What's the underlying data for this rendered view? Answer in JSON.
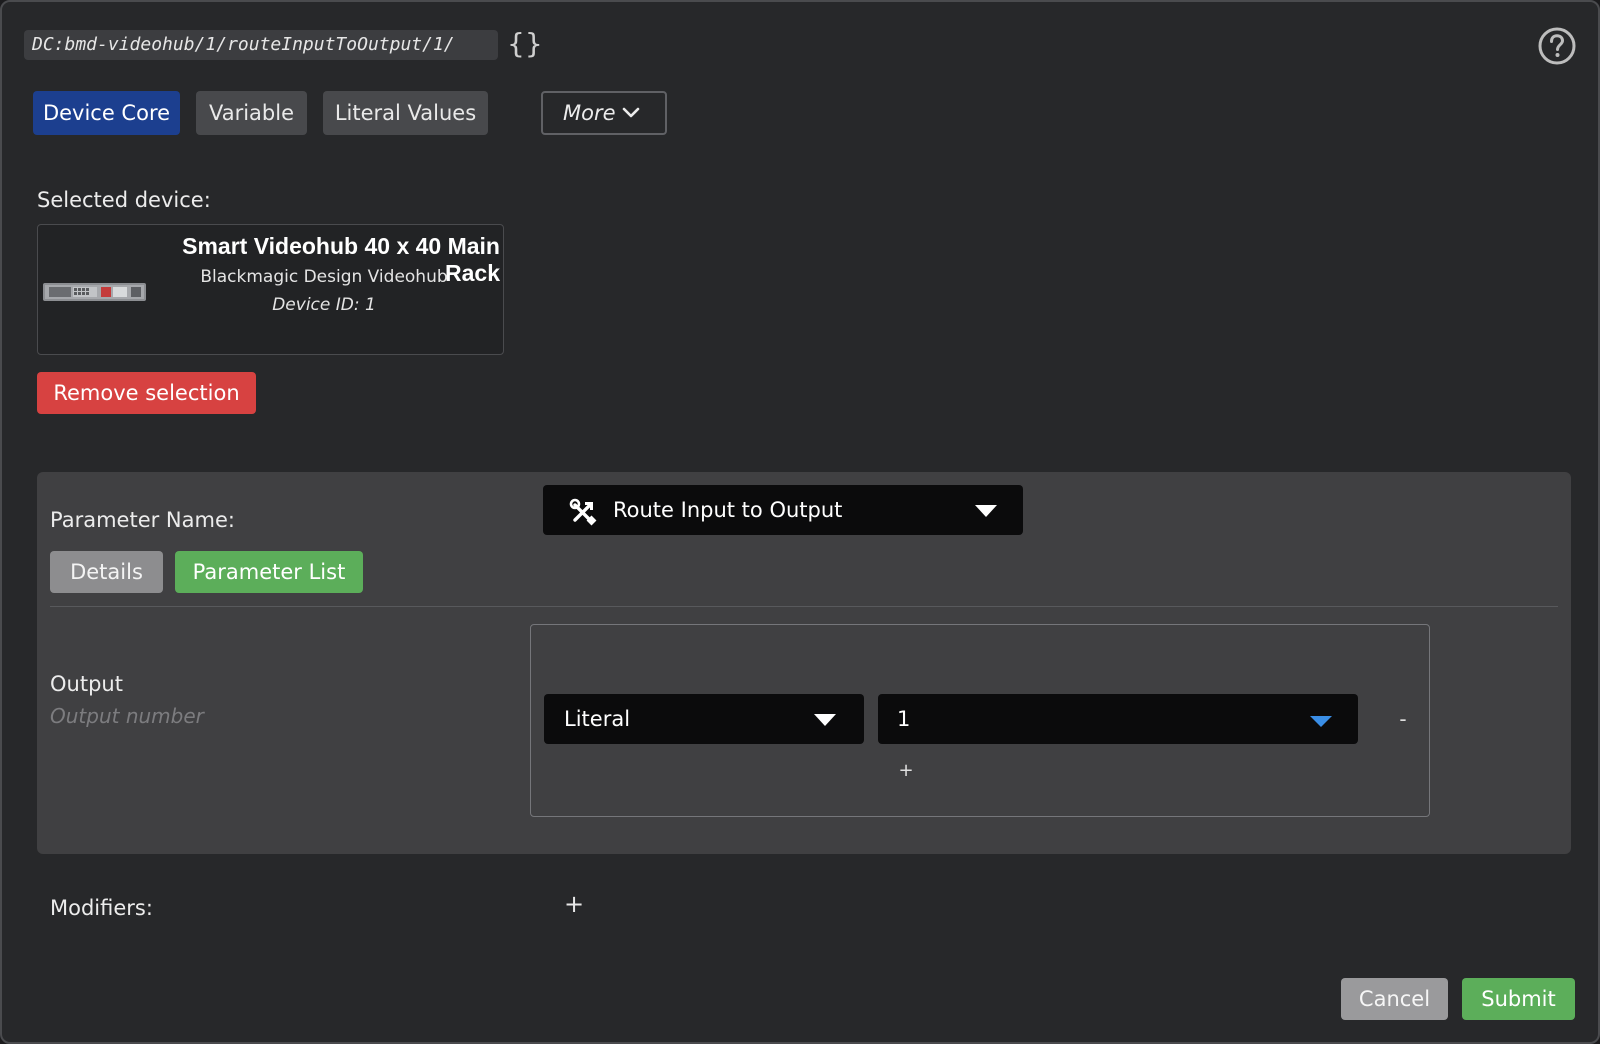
{
  "header": {
    "path": "DC:bmd-videohub/1/routeInputToOutput/1/",
    "braces_label": "{}",
    "help_icon": "question-circle-icon"
  },
  "tabs": [
    {
      "label": "Device Core",
      "active": true
    },
    {
      "label": "Variable",
      "active": false
    },
    {
      "label": "Literal Values",
      "active": false
    }
  ],
  "more_tab": {
    "label": "More",
    "icon": "chevron-down-icon"
  },
  "device": {
    "selected_label": "Selected device:",
    "name": "Smart Videohub 40 x 40 Main Rack",
    "model": "Blackmagic Design Videohub",
    "id_text": "Device ID: 1",
    "image_icon": "rack-device-icon",
    "remove_label": "Remove selection"
  },
  "parameter": {
    "name_label": "Parameter Name:",
    "selected": "Route Input to Output",
    "selected_icon": "tools-icon",
    "details_label": "Details",
    "param_list_label": "Parameter List"
  },
  "output": {
    "label": "Output",
    "help_text": "Output number",
    "type_value": "Literal",
    "value": "1",
    "remove_label": "-",
    "add_label": "+"
  },
  "modifiers": {
    "label": "Modifiers:",
    "add_label": "+"
  },
  "footer": {
    "cancel_label": "Cancel",
    "submit_label": "Submit"
  },
  "colors": {
    "active_tab": "#1c3f8f",
    "danger": "#d74241",
    "success": "#5cae5a",
    "caret_accent": "#3a8ee6"
  }
}
